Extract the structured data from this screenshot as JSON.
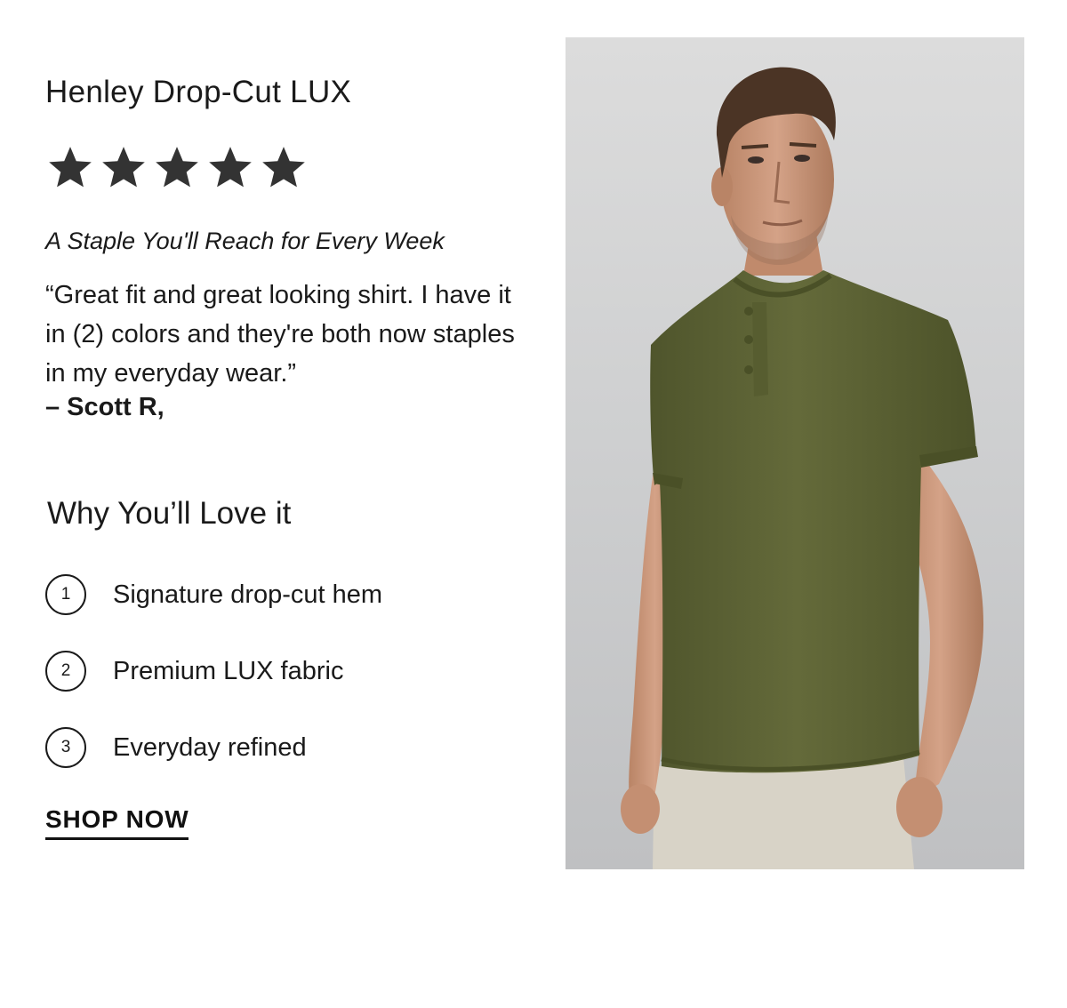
{
  "product": {
    "title": "Henley Drop-Cut LUX",
    "rating": 5,
    "rating_max": 5,
    "tagline": "A Staple You'll Reach for Every Week",
    "review_quote": "“Great fit and great looking shirt. I have it in (2) colors and they're both now staples in my everyday wear.”",
    "review_author": "– Scott R,"
  },
  "why": {
    "title": "Why You’ll Love it",
    "items": [
      {
        "number": "1",
        "label": "Signature drop-cut hem"
      },
      {
        "number": "2",
        "label": "Premium LUX fabric"
      },
      {
        "number": "3",
        "label": "Everyday refined"
      }
    ]
  },
  "cta": {
    "label": "SHOP NOW"
  },
  "colors": {
    "text": "#1a1a1a",
    "star": "#333333",
    "shirt": "#5f6536",
    "photo_bg": "#cfd0d1"
  },
  "icons": {
    "star": "star-icon",
    "photo": "model-photo"
  }
}
